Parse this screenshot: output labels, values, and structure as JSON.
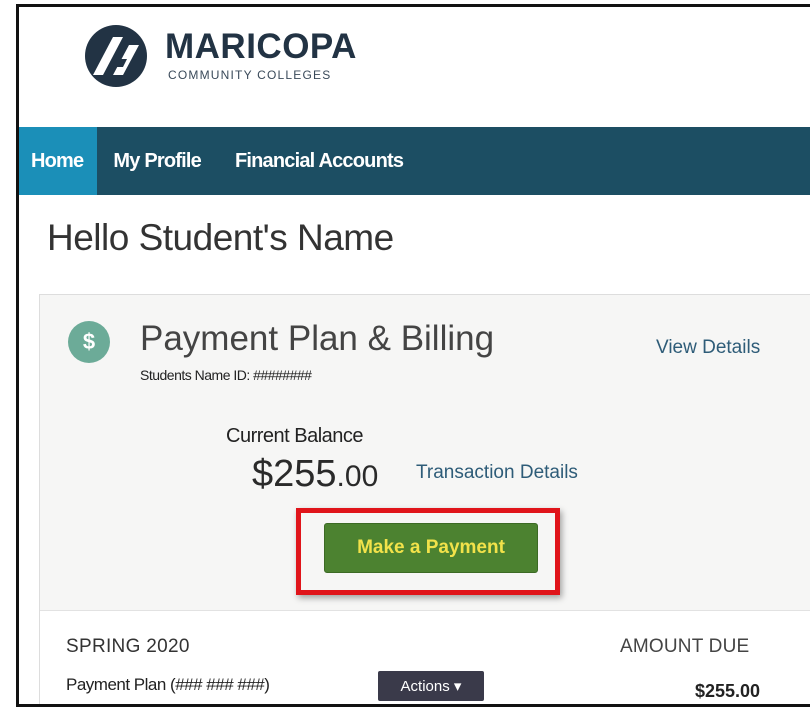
{
  "brand": {
    "name": "MARICOPA",
    "subtitle": "COMMUNITY COLLEGES"
  },
  "nav": {
    "items": [
      {
        "label": "Home",
        "active": true
      },
      {
        "label": "My Profile",
        "active": false
      },
      {
        "label": "Financial Accounts",
        "active": false
      }
    ]
  },
  "greeting": "Hello Student's Name",
  "card": {
    "icon": "dollar-icon",
    "icon_glyph": "$",
    "title": "Payment Plan & Billing",
    "view_details": "View Details",
    "student_id": "Students Name ID: ########",
    "balance_label": "Current Balance",
    "balance_dollars": "$255",
    "balance_cents": ".00",
    "transaction_details": "Transaction Details",
    "pay_button": "Make a Payment",
    "term": "SPRING 2020",
    "amount_due_label": "AMOUNT DUE",
    "plan_label": "Payment Plan (### ### ###)",
    "actions_label": "Actions ▾",
    "amount_due_value": "$255.00"
  },
  "colors": {
    "nav_bg": "#1c4e63",
    "nav_active": "#1b8fb8",
    "pay_button_bg": "#4c8230",
    "pay_button_text": "#f2e24a",
    "highlight": "#e0141a",
    "link": "#2e5c78",
    "badge": "#6cab98"
  }
}
